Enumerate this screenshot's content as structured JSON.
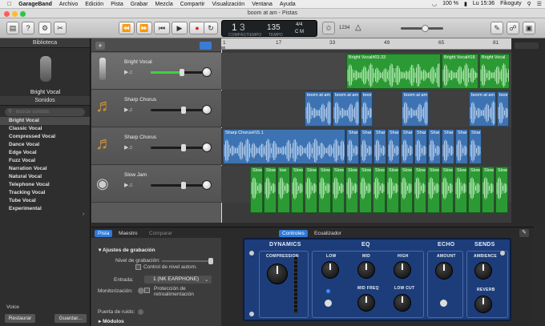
{
  "menubar": {
    "app": "GarageBand",
    "items": [
      "Archivo",
      "Edición",
      "Pista",
      "Grabar",
      "Mezcla",
      "Compartir",
      "Visualización",
      "Ventana",
      "Ayuda"
    ],
    "battery": "100 %",
    "clock": "Lu 15:36",
    "user": "Fikoguty"
  },
  "window": {
    "title": "boom at am - Pistas"
  },
  "lcd": {
    "bar": "1",
    "beat": "3",
    "bar_label": "COMPÁS",
    "beat_label": "TIEMPO",
    "tempo": "135",
    "tempo_label": "TEMPO",
    "signature": "4/4",
    "key": "C M",
    "count_in": "1234"
  },
  "library": {
    "header": "Biblioteca",
    "patch": "Bright Vocal",
    "sounds_header": "Sonidos",
    "search_placeholder": "Buscar sonidos",
    "sounds": [
      "Bright Vocal",
      "Classic Vocal",
      "Compressed Vocal",
      "Dance Vocal",
      "Edge Vocal",
      "Fuzz Vocal",
      "Narration Vocal",
      "Natural Vocal",
      "Telephone Vocal",
      "Tracking Vocal",
      "Tube Vocal",
      "Experimental"
    ],
    "footer_label": "Voice",
    "restore": "Restaurar",
    "save": "Guardar..."
  },
  "tracks": [
    {
      "name": "Bright Vocal",
      "volume": 0.6
    },
    {
      "name": "Sharp Chorus",
      "volume": 0.6
    },
    {
      "name": "Sharp Chorus",
      "volume": 0.6
    },
    {
      "name": "Slow Jam",
      "volume": 0.6
    }
  ],
  "ruler": [
    "1",
    "17",
    "33",
    "49",
    "65",
    "81"
  ],
  "regions": {
    "vocal": [
      "Bright Vocal#03.33",
      "Bright Vocal#18",
      "Bright Vocal"
    ],
    "chorus1": [
      "boom at am",
      "boom at am",
      "boom",
      "boom at am",
      "boom at am",
      "boom"
    ],
    "chorus2": [
      "Sharp Chorus#15.1",
      "Shar",
      "Shar",
      "Shar",
      "Shar",
      "Shar",
      "Shar",
      "Shar",
      "Shar",
      "Shar",
      "Shar"
    ],
    "slowjam": [
      "Slow",
      "Slow",
      "low",
      "Slow",
      "Slow",
      "Slow",
      "Slow",
      "Slow",
      "Slow",
      "Slow",
      "Slow",
      "Slow",
      "Slow",
      "Slow",
      "Slow",
      "Slow",
      "Slow",
      "Slow",
      "Slow"
    ]
  },
  "editor": {
    "tabs": [
      "Pista",
      "Maestro",
      "Comparar"
    ],
    "right_tabs": [
      "Controles",
      "Ecualizador"
    ],
    "rec_settings": "Ajustes de grabación",
    "rec_level": "Nivel de grabación:",
    "auto_control": "Control de nivel autom.",
    "input_label": "Entrada:",
    "input_value": "1 (NK EARPHONE)",
    "monitoring": "Monitorización:",
    "feedback": "Protección de retroalimentación",
    "noise_gate": "Puerta de ruido:",
    "modules": "Módulos"
  },
  "plugin": {
    "dynamics": "DYNAMICS",
    "compression": "COMPRESSION",
    "eq": "EQ",
    "low": "LOW",
    "mid": "MID",
    "high": "HIGH",
    "mid_freq": "MID FREQ",
    "low_cut": "LOW CUT",
    "echo": "ECHO",
    "amount": "AMOUNT",
    "sends": "SENDS",
    "ambience": "AMBIENCE",
    "reverb": "REVERB"
  }
}
